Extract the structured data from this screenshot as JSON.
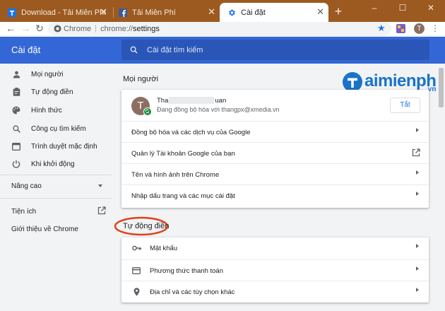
{
  "tabs": [
    {
      "title": "Download - Tải Miễn Phí VN - Ph",
      "favicon": "t-icon"
    },
    {
      "title": "Tải Miễn Phí",
      "favicon": "facebook-icon"
    },
    {
      "title": "Cài đặt",
      "favicon": "gear-icon"
    }
  ],
  "omnibox": {
    "chip": "Chrome",
    "scheme": "chrome://",
    "path": "settings"
  },
  "profile_initial": "T",
  "header": {
    "title": "Cài đặt",
    "search_placeholder": "Cài đặt tìm kiếm"
  },
  "sidebar": {
    "items": [
      {
        "label": "Mọi người",
        "icon": "person-icon"
      },
      {
        "label": "Tự động điền",
        "icon": "clipboard-icon"
      },
      {
        "label": "Hình thức",
        "icon": "palette-icon"
      },
      {
        "label": "Công cụ tìm kiếm",
        "icon": "search-icon"
      },
      {
        "label": "Trình duyệt mặc định",
        "icon": "browser-icon"
      },
      {
        "label": "Khi khởi động",
        "icon": "power-icon"
      }
    ],
    "advanced": "Nâng cao",
    "extensions": "Tiện ích",
    "about": "Giới thiệu về Chrome"
  },
  "people": {
    "section_title": "Mọi người",
    "account_name_start": "Tha",
    "account_name_end": "uan",
    "account_initial": "T",
    "sync_status": "Đang đồng bộ hóa với thangpx@xmedia.vn",
    "turn_off_button": "Tắt",
    "rows": [
      "Đồng bộ hóa và các dịch vụ của Google",
      "Quản lý Tài khoản Google của bạn",
      "Tên và hình ảnh trên Chrome",
      "Nhập dấu trang và các mục cài đặt"
    ]
  },
  "autofill": {
    "section_title": "Tự động điền",
    "rows": [
      {
        "label": "Mật khẩu",
        "icon": "key-icon"
      },
      {
        "label": "Phương thức thanh toán",
        "icon": "credit-card-icon"
      },
      {
        "label": "Địa chỉ và các tùy chọn khác",
        "icon": "location-pin-icon"
      }
    ]
  },
  "watermark": {
    "brand": "aimienphi",
    "initial": "T",
    "domain": ".vn"
  },
  "colors": {
    "accent": "#3367d6",
    "frame": "#9c5a20",
    "highlight": "#e0421c",
    "sync_badge": "#1e8e3e",
    "avatar": "#8d6e63"
  }
}
